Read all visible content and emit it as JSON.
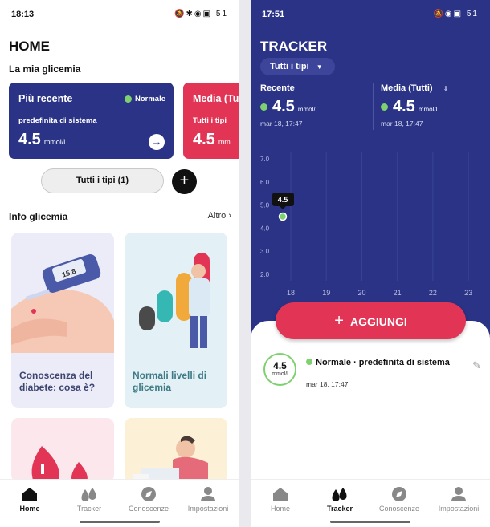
{
  "left": {
    "status_time": "18:13",
    "status_icons": "🔕✱◉▣ 51",
    "title": "HOME",
    "subtitle": "La mia glicemia",
    "card_recent": {
      "title": "Più recente",
      "badge": "Normale",
      "subtitle": "predefinita di sistema",
      "value": "4.5",
      "unit": "mmol/l"
    },
    "card_average": {
      "title": "Media (Tu",
      "subtitle": "Tutti i tipi",
      "value": "4.5",
      "unit": "mm"
    },
    "filter_pill": "Tutti i tipi (1)",
    "info_heading": "Info glicemia",
    "info_more": "Altro",
    "tiles": [
      {
        "title": "Conoscenza del diabete: cosa è?"
      },
      {
        "title": "Normali livelli di glicemia"
      }
    ],
    "meter_reading": "15.8"
  },
  "right": {
    "status_time": "17:51",
    "status_icons": "🔕◉▣ 51",
    "title": "TRACKER",
    "filter": "Tutti i tipi",
    "stat_recent": {
      "label": "Recente",
      "value": "4.5",
      "unit": "mmol/l",
      "date": "mar 18, 17:47"
    },
    "stat_average": {
      "label": "Media (Tutti)",
      "value": "4.5",
      "unit": "mmol/l",
      "date": "mar 18, 17:47"
    },
    "add_button": "AGGIUNGI",
    "entry": {
      "value": "4.5",
      "unit": "mmol/l",
      "title": "Normale · predefinita di sistema",
      "date": "mar 18, 17:47"
    }
  },
  "nav": [
    {
      "label": "Home",
      "icon": "home-icon"
    },
    {
      "label": "Tracker",
      "icon": "drops-icon"
    },
    {
      "label": "Conoscenze",
      "icon": "compass-icon"
    },
    {
      "label": "Impostazioni",
      "icon": "person-icon"
    }
  ],
  "colors": {
    "navy": "#2a3386",
    "red": "#e23556",
    "green": "#7fd170"
  },
  "chart_data": {
    "type": "scatter",
    "x_ticks": [
      "18",
      "19",
      "20",
      "21",
      "22",
      "23"
    ],
    "y_ticks": [
      "7.0",
      "6.0",
      "5.0",
      "4.0",
      "3.0",
      "2.0"
    ],
    "ylim": [
      2.0,
      7.0
    ],
    "points": [
      {
        "x": "18",
        "y": 4.5,
        "label": "4.5"
      }
    ]
  }
}
